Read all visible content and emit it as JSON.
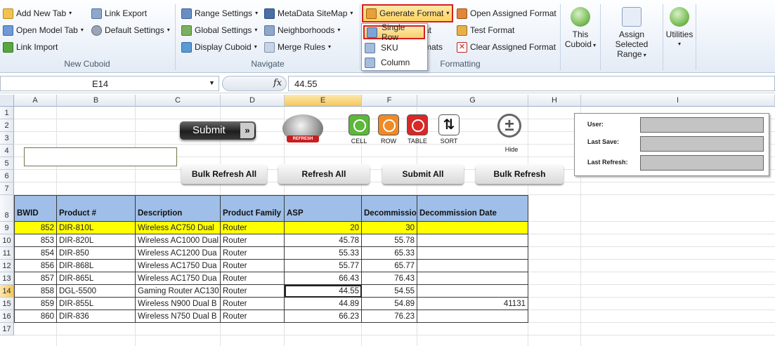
{
  "ribbon": {
    "group1": {
      "label": "New Cuboid",
      "items": [
        "Add New Tab",
        "Open Model Tab",
        "Link Import",
        "Link Export",
        "Default Settings"
      ]
    },
    "group2": {
      "label": "Navigate",
      "items": [
        "Range Settings",
        "Global Settings",
        "Display Cuboid",
        "MetaData SiteMap",
        "Neighborhoods",
        "Merge Rules"
      ]
    },
    "group3": {
      "label": "Formatting",
      "generate_format": "Generate Format",
      "hidden_text_1": "at",
      "hidden_text_2": "mats",
      "open_assigned": "Open Assigned Format",
      "test_format": "Test Format",
      "clear_assigned": "Clear Assigned Format"
    },
    "dropdown": {
      "items": [
        "Single Row",
        "SKU",
        "Column"
      ]
    },
    "big_buttons": [
      {
        "line1": "This",
        "line2": "Cuboid"
      },
      {
        "line1": "Assign Selected",
        "line2": "Range"
      },
      {
        "line1": "Utilities",
        "line2": ""
      }
    ]
  },
  "formula_bar": {
    "name_box": "E14",
    "fx": "fx",
    "value": "44.55"
  },
  "columns": [
    "A",
    "B",
    "C",
    "D",
    "E",
    "F",
    "G",
    "H",
    "I"
  ],
  "rows": [
    "1",
    "2",
    "3",
    "4",
    "5",
    "6",
    "7",
    "8",
    "9",
    "10",
    "11",
    "12",
    "13",
    "14",
    "15",
    "16",
    "17"
  ],
  "controls": {
    "submit": "Submit",
    "refresh_logo": "REFRESH",
    "mini_buttons": [
      "CELL",
      "ROW",
      "TABLE",
      "SORT"
    ],
    "hide": "Hide",
    "action_buttons": [
      "Bulk Refresh All",
      "Refresh All",
      "Submit All",
      "Bulk Refresh"
    ],
    "info_labels": [
      "User:",
      "Last Save:",
      "Last Refresh:"
    ]
  },
  "table": {
    "headers": [
      "BWID",
      "Product #",
      "Description",
      "Product Family",
      "ASP",
      "Decommissioned",
      "Decommission Date"
    ],
    "rows": [
      [
        "852",
        "DIR-810L",
        "Wireless AC750 Dual",
        "Router",
        "20",
        "30",
        ""
      ],
      [
        "853",
        "DIR-820L",
        "Wireless AC1000 Dual",
        "Router",
        "45.78",
        "55.78",
        ""
      ],
      [
        "854",
        "DIR-850",
        "Wireless AC1200 Dua",
        "Router",
        "55.33",
        "65.33",
        ""
      ],
      [
        "856",
        "DIR-868L",
        "Wireless AC1750 Dua",
        "Router",
        "55.77",
        "65.77",
        ""
      ],
      [
        "857",
        "DIR-865L",
        "Wireless AC1750 Dua",
        "Router",
        "66.43",
        "76.43",
        ""
      ],
      [
        "858",
        "DGL-5500",
        "Gaming Router AC130",
        "Router",
        "44.55",
        "54.55",
        ""
      ],
      [
        "859",
        "DIR-855L",
        "Wireless N900 Dual B",
        "Router",
        "44.89",
        "54.89",
        "41131"
      ],
      [
        "860",
        "DIR-836",
        "Wireless N750 Dual B",
        "Router",
        "66.23",
        "76.23",
        ""
      ]
    ]
  },
  "colors": {
    "highlight_row": "#ffff00",
    "header_fill": "#9fbfe8",
    "accent_red": "#d42020"
  }
}
